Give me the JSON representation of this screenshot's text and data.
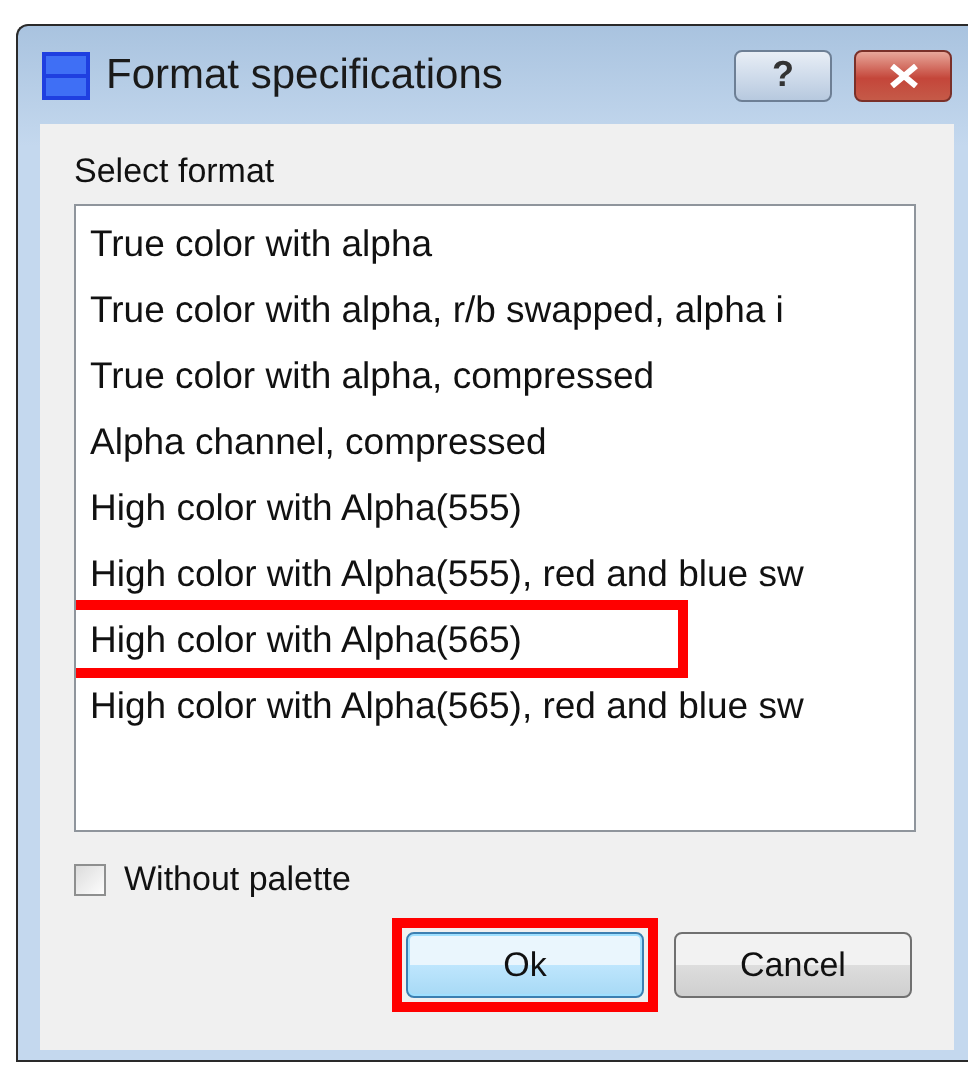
{
  "window": {
    "title": "Format specifications",
    "help_button": "?"
  },
  "list_label": "Select format",
  "formats": [
    {
      "label": "True color with alpha",
      "marked": false
    },
    {
      "label": "True color with alpha, r/b swapped, alpha i",
      "marked": false
    },
    {
      "label": "True color with alpha, compressed",
      "marked": false
    },
    {
      "label": "Alpha channel, compressed",
      "marked": false
    },
    {
      "label": "High color with Alpha(555)",
      "marked": false
    },
    {
      "label": "High color with Alpha(555), red and blue sw",
      "marked": false
    },
    {
      "label": "High color with Alpha(565)",
      "marked": true
    },
    {
      "label": "High color with Alpha(565), red and blue sw",
      "marked": false
    }
  ],
  "without_palette": {
    "label": "Without palette",
    "checked": false
  },
  "buttons": [
    {
      "label": "Ok",
      "focused": true,
      "marked": true
    },
    {
      "label": "Cancel",
      "focused": false,
      "marked": false
    }
  ]
}
